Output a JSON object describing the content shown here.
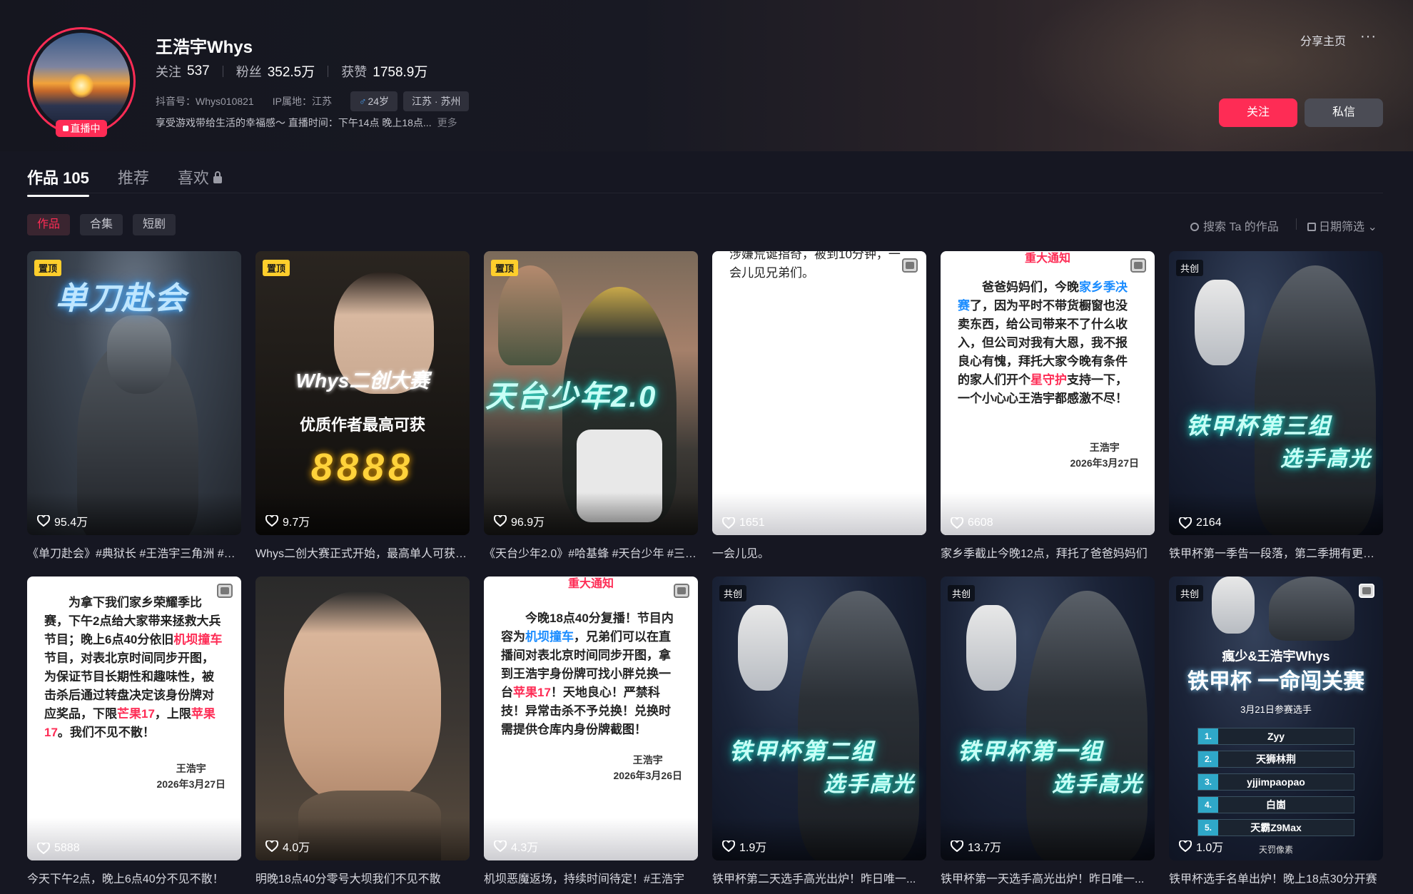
{
  "profile": {
    "name": "王浩宇Whys",
    "live_label": "直播中",
    "stats": [
      {
        "label": "关注",
        "value": "537"
      },
      {
        "label": "粉丝",
        "value": "352.5万"
      },
      {
        "label": "获赞",
        "value": "1758.9万"
      }
    ],
    "douyin_id": "抖音号：Whys010821",
    "ip": "IP属地：江苏",
    "gender_age": "24岁",
    "location": "江苏 · 苏州",
    "bio": "享受游戏带给生活的幸福感～ 直播时间：下午14点 晚上18点...",
    "more": "更多"
  },
  "actions": {
    "share": "分享主页",
    "more": "···",
    "follow": "关注",
    "message": "私信"
  },
  "tabs": [
    {
      "label": "作品 105",
      "active": true
    },
    {
      "label": "推荐",
      "active": false
    },
    {
      "label": "喜欢",
      "active": false
    }
  ],
  "filters": [
    "作品",
    "合集",
    "短剧"
  ],
  "search_label": "搜索 Ta 的作品",
  "date_filter_label": "日期筛选",
  "badges": {
    "pin": "置顶",
    "cocreate": "共创"
  },
  "videos": [
    {
      "likes": "95.4万",
      "caption": "《单刀赴会》#典狱长 #王浩宇三角洲 #三角洲行动",
      "art": "单刀赴会"
    },
    {
      "likes": "9.7万",
      "caption": "Whys二创大赛正式开始，最高单人可获8888元",
      "art1": "Whys二创大赛",
      "art2": "优质作者最高可获",
      "art3": "8888"
    },
    {
      "likes": "96.9万",
      "caption": "《天台少年2.0》#哈基蜂 #天台少年 #三角洲",
      "art": "天台少年2.0"
    },
    {
      "likes": "1651",
      "caption": "一会儿见。",
      "text": "涉嫌荒诞指奇，被到10分钟，一会儿见兄弟们。"
    },
    {
      "likes": "6608",
      "caption": "家乡季截止今晚12点，拜托了爸爸妈妈们",
      "top": "重大通知",
      "t1": "爸爸妈妈们，今晚",
      "t2": "家乡季决赛",
      "t3": "了，因为平时不带货橱窗也没卖东西，给公司带来不了什么收入，但公司对我有大恩，我不报良心有愧，拜托大家今晚有条件的家人们开个",
      "t4": "星守护",
      "t5": "支持一下，一个小心心王浩宇都感激不尽！",
      "sign1": "王浩宇",
      "sign2": "2026年3月27日"
    },
    {
      "likes": "2164",
      "caption": "铁甲杯第一季告一段落，第二季拥有更多精彩",
      "art1": "铁甲杯第三组",
      "art2": "选手高光"
    },
    {
      "likes": "5888",
      "caption": "今天下午2点，晚上6点40分不见不散！",
      "t1": "为拿下我们家乡荣耀季比赛，下午2点给大家带来拯救大兵节目；晚上6点40分依旧",
      "t2": "机坝撞车",
      "t3": "节目，对表北京时间同步开图，为保证节目长期性和趣味性，被击杀后通过转盘决定该身份牌对应奖品，下限",
      "t4": "芒果17",
      "t5": "，上限",
      "t6": "苹果17",
      "t7": "。我们不见不散！",
      "sign1": "王浩宇",
      "sign2": "2026年3月27日"
    },
    {
      "likes": "4.0万",
      "caption": "明晚18点40分零号大坝我们不见不散"
    },
    {
      "likes": "4.3万",
      "caption": "机坝恶魔返场，持续时间待定！#王浩宇",
      "top": "重大通知",
      "t1": "今晚18点40分复播！节目内容为",
      "t2": "机坝撞车",
      "t3": "，兄弟们可以在直播间对表北京时间同步开图，拿到王浩宇身份牌可找小胖兑换一台",
      "t4": "苹果17",
      "t5": "！天地良心！严禁科技！异常击杀不予兑换！兑换时需提供仓库内身份牌截图！",
      "sign1": "王浩宇",
      "sign2": "2026年3月26日"
    },
    {
      "likes": "1.9万",
      "caption": "铁甲杯第二天选手高光出炉！昨日唯一...",
      "art1": "铁甲杯第二组",
      "art2": "选手高光"
    },
    {
      "likes": "13.7万",
      "caption": "铁甲杯第一天选手高光出炉！昨日唯一...",
      "art1": "铁甲杯第一组",
      "art2": "选手高光"
    },
    {
      "likes": "1.0万",
      "caption": "铁甲杯选手名单出炉！晚上18点30分开赛",
      "art1": "瘋少&王浩宇Whys",
      "art2": "铁甲杯 一命闯关赛",
      "art3": "3月21日参赛选手",
      "players": [
        "Zyy",
        "天狮林荆",
        "yjjimpaopao",
        "白崮",
        "天霸Z9Max",
        "天罚像素"
      ]
    }
  ],
  "colors": {
    "accent": "#fe2c55",
    "pin": "#fece2c",
    "highlight_blue": "#1a8cff"
  }
}
